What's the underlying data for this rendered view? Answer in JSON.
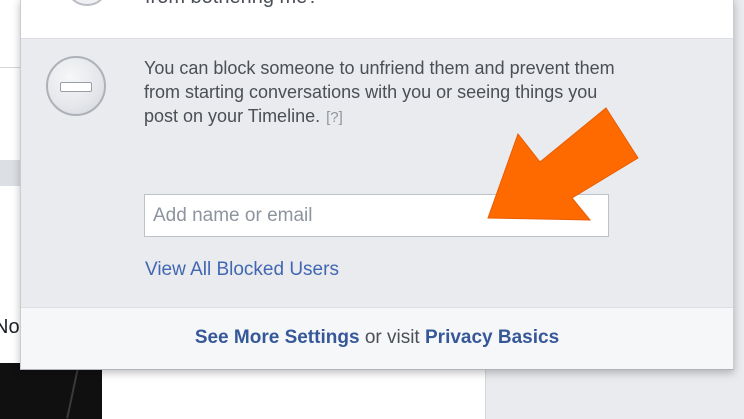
{
  "background": {
    "left_fragment_text": "No"
  },
  "popup": {
    "top_question_text": "from bothering me?",
    "block": {
      "description": "You can block someone to unfriend them and prevent them from starting conversations with you or seeing things you post on your Timeline.",
      "help_link": "[?]",
      "input": {
        "placeholder": "Add name or email",
        "value": ""
      },
      "view_blocked_label": "View All Blocked Users"
    },
    "footer": {
      "see_more_label": "See More Settings",
      "middle_text": "or visit",
      "privacy_basics_label": "Privacy Basics"
    }
  },
  "icons": {
    "block_icon": "minus-circle-icon",
    "annotation_arrow": "orange-arrow-icon"
  },
  "colors": {
    "link_blue": "#4267b2",
    "annotation_orange": "#ff6a00",
    "section_gray": "#e9ebee"
  }
}
